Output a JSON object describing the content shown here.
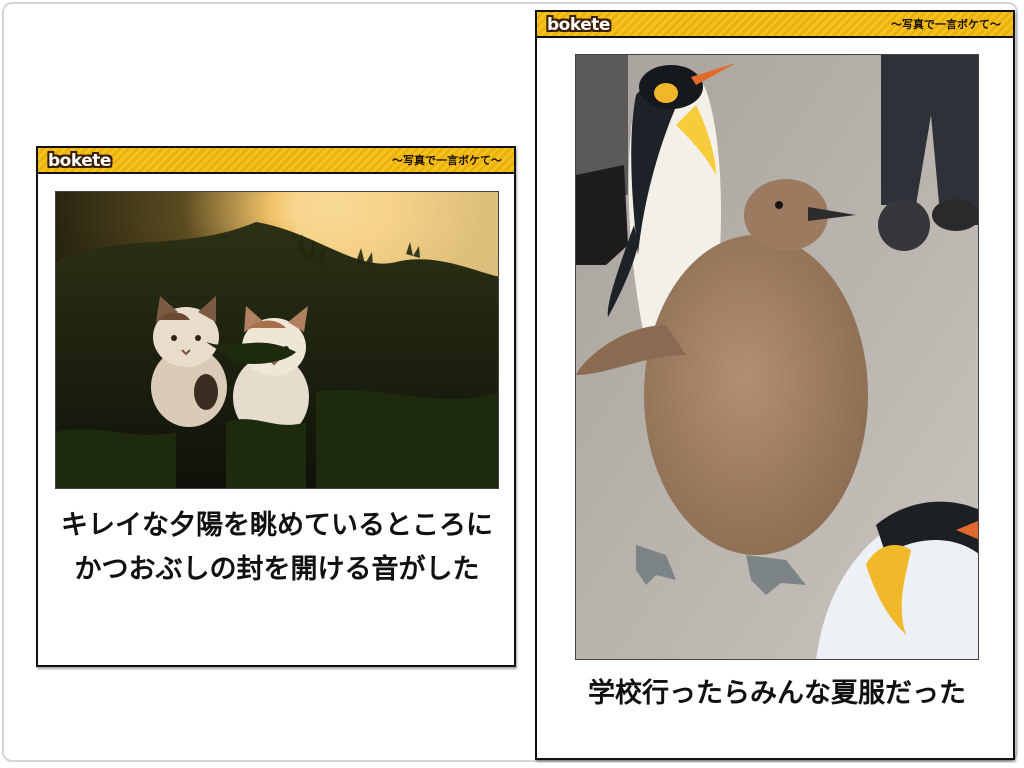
{
  "cards": [
    {
      "logo": "bokete",
      "tagline": "〜写真で一言ボケて〜",
      "photo_icon": "cats-at-sunset-photo",
      "caption": "キレイな夕陽を眺めているところにかつおぶしの封を開ける音がした"
    },
    {
      "logo": "bokete",
      "tagline": "〜写真で一言ボケて〜",
      "photo_icon": "penguin-chick-photo",
      "caption": "学校行ったらみんな夏服だった"
    }
  ],
  "colors": {
    "header_yellow": "#f7c21c",
    "border": "#111111",
    "logo_outline": "#3a1e00"
  }
}
